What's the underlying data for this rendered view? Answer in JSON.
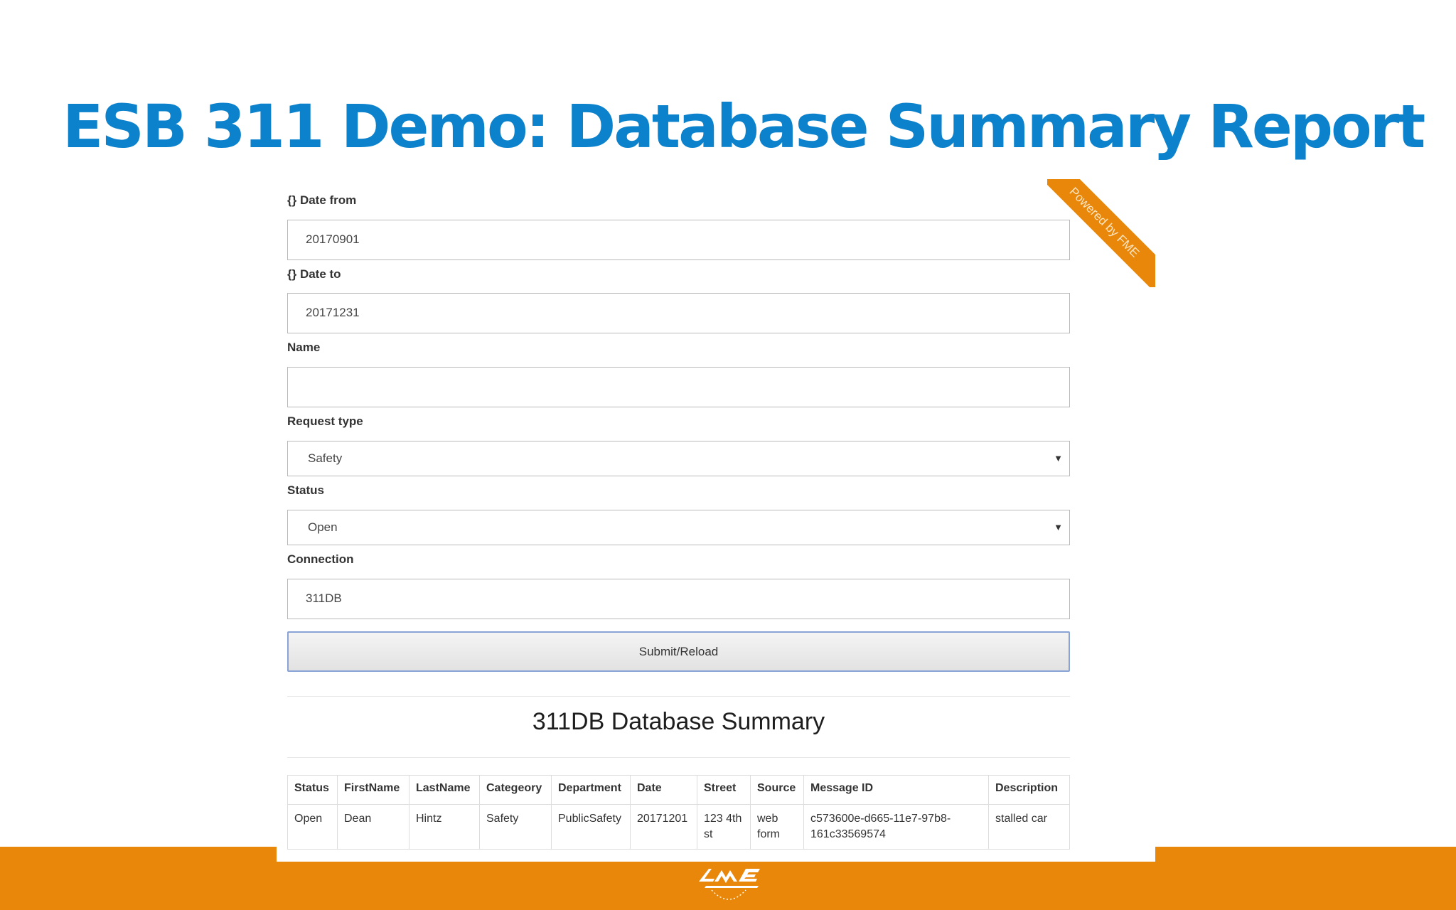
{
  "slide": {
    "title": "ESB 311 Demo: Database Summary Report"
  },
  "ribbon": {
    "text": "Powered by FME"
  },
  "form": {
    "date_from": {
      "label": "{} Date from",
      "value": "20170901"
    },
    "date_to": {
      "label": "{} Date to",
      "value": "20171231"
    },
    "name": {
      "label": "Name",
      "value": ""
    },
    "request_type": {
      "label": "Request type",
      "selected": "Safety"
    },
    "status": {
      "label": "Status",
      "selected": "Open"
    },
    "connection": {
      "label": "Connection",
      "value": "311DB"
    },
    "submit_label": "Submit/Reload"
  },
  "report": {
    "title": "311DB Database Summary",
    "columns": [
      "Status",
      "FirstName",
      "LastName",
      "Categeory",
      "Department",
      "Date",
      "Street",
      "Source",
      "Message ID",
      "Description"
    ],
    "rows": [
      [
        "Open",
        "Dean",
        "Hintz",
        "Safety",
        "PublicSafety",
        "20171201",
        "123 4th st",
        "web form",
        "c573600e-d665-11e7-97b8-161c33569574",
        "stalled car"
      ]
    ]
  },
  "colors": {
    "title_blue": "#0d82cc",
    "fme_orange": "#e8870a"
  },
  "icons": {
    "footer_logo": "fme-logo-icon",
    "select_caret": "caret-down-icon"
  }
}
